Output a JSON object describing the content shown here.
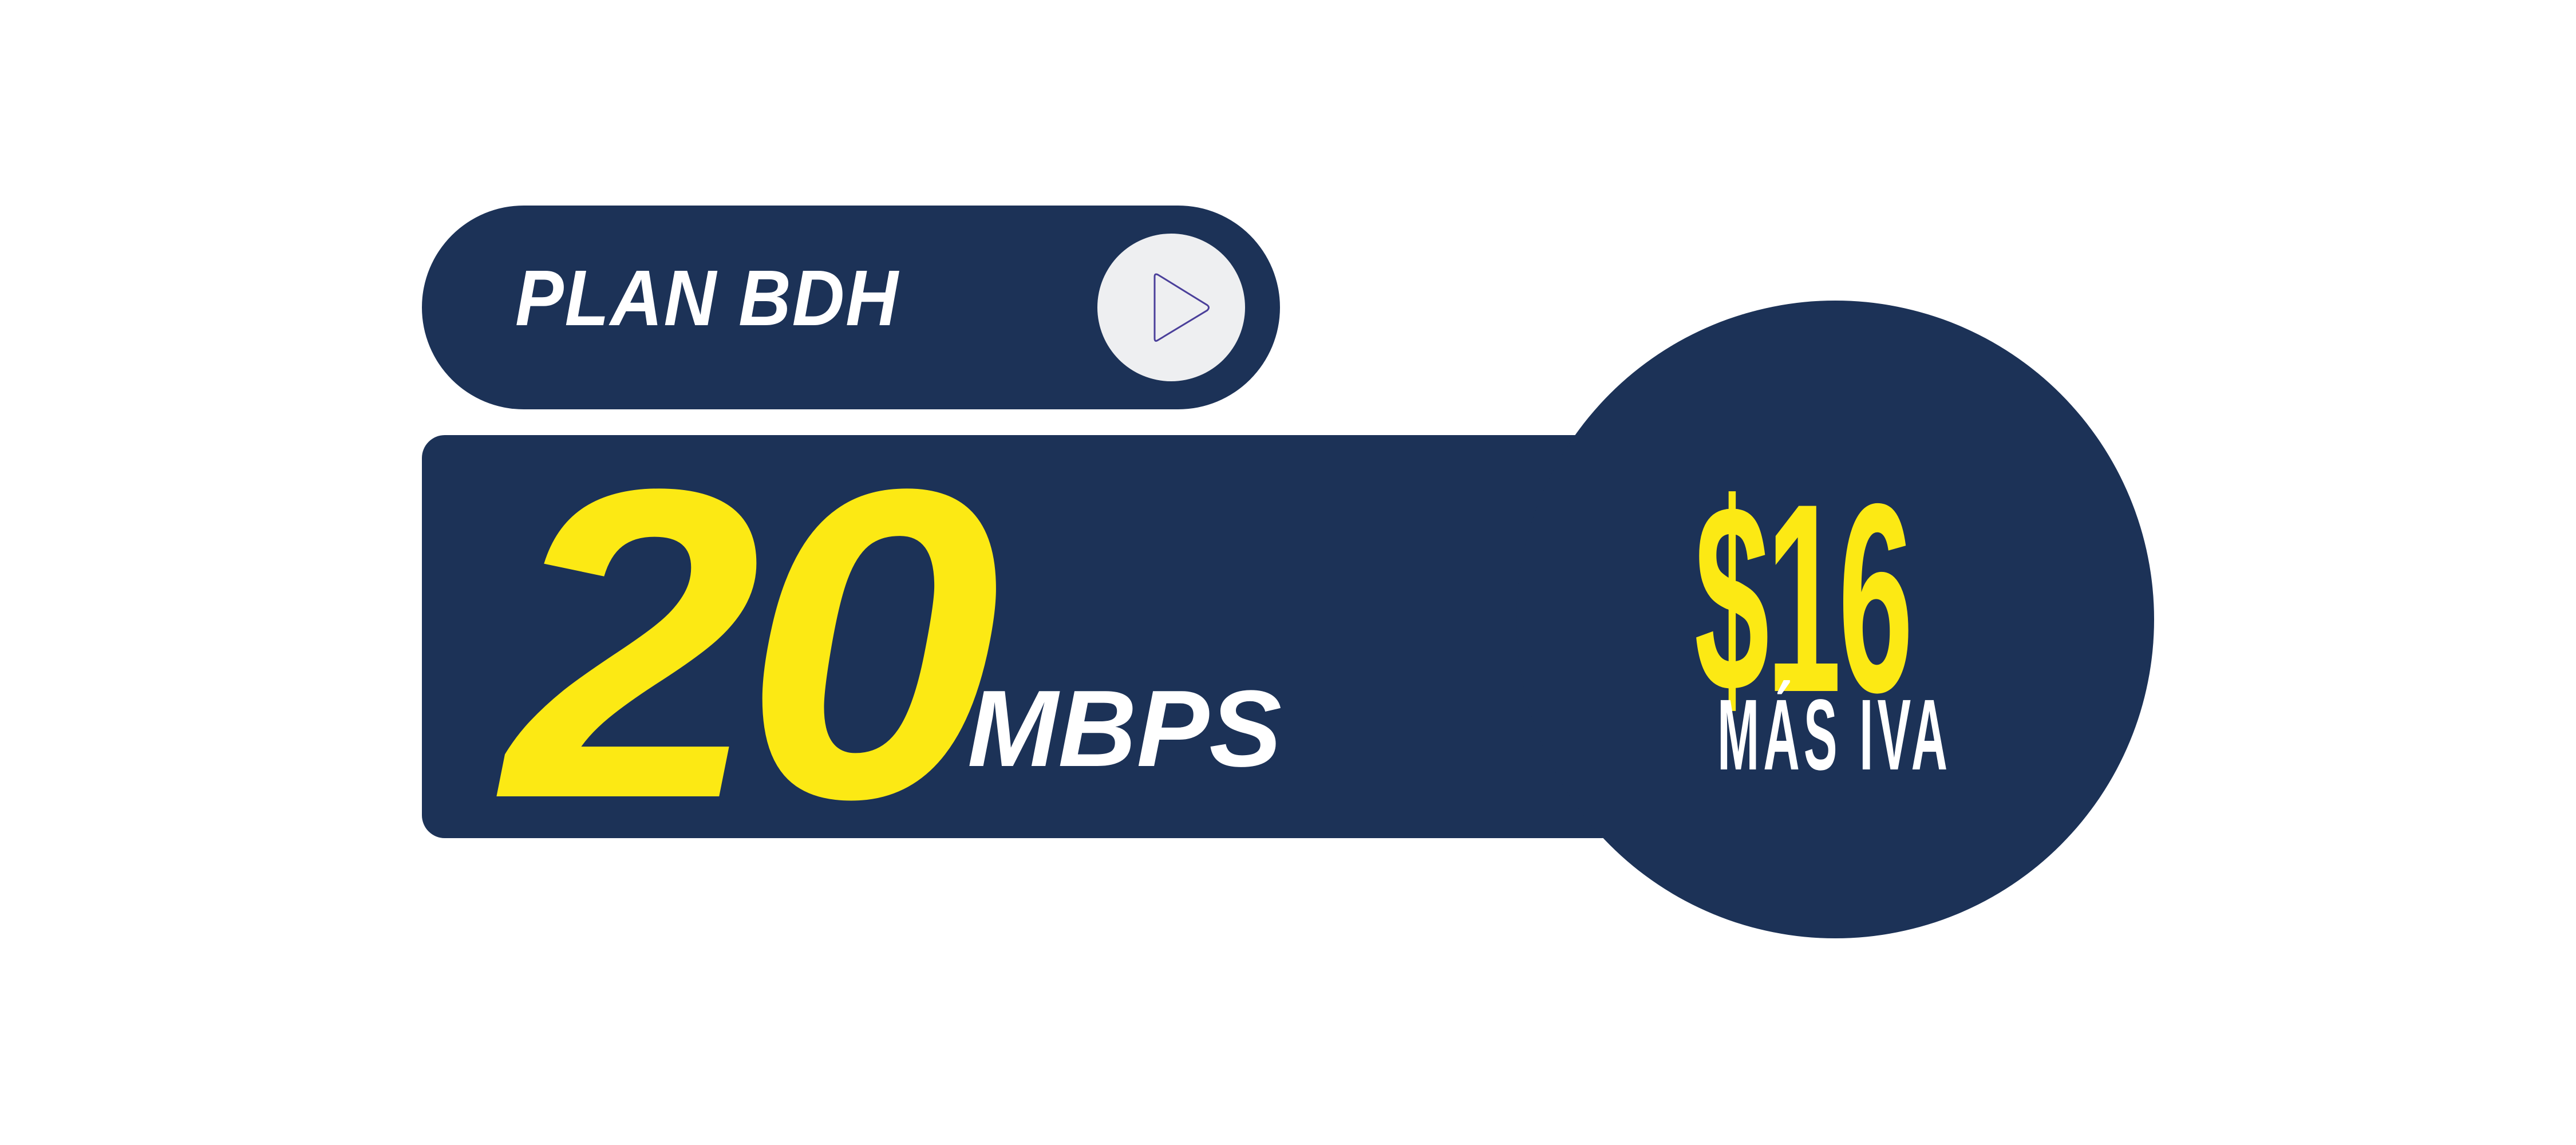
{
  "plan": {
    "title": "PLAN BDH",
    "play_icon": "play-icon"
  },
  "speed": {
    "value": "20",
    "unit": "MBPS"
  },
  "price": {
    "amount": "$16",
    "note": "MÁS IVA"
  },
  "colors": {
    "navy": "#1c3257",
    "yellow": "#fce914",
    "white": "#ffffff",
    "play_bg": "#eeeff1",
    "play_stroke": "#4a3f9a"
  }
}
